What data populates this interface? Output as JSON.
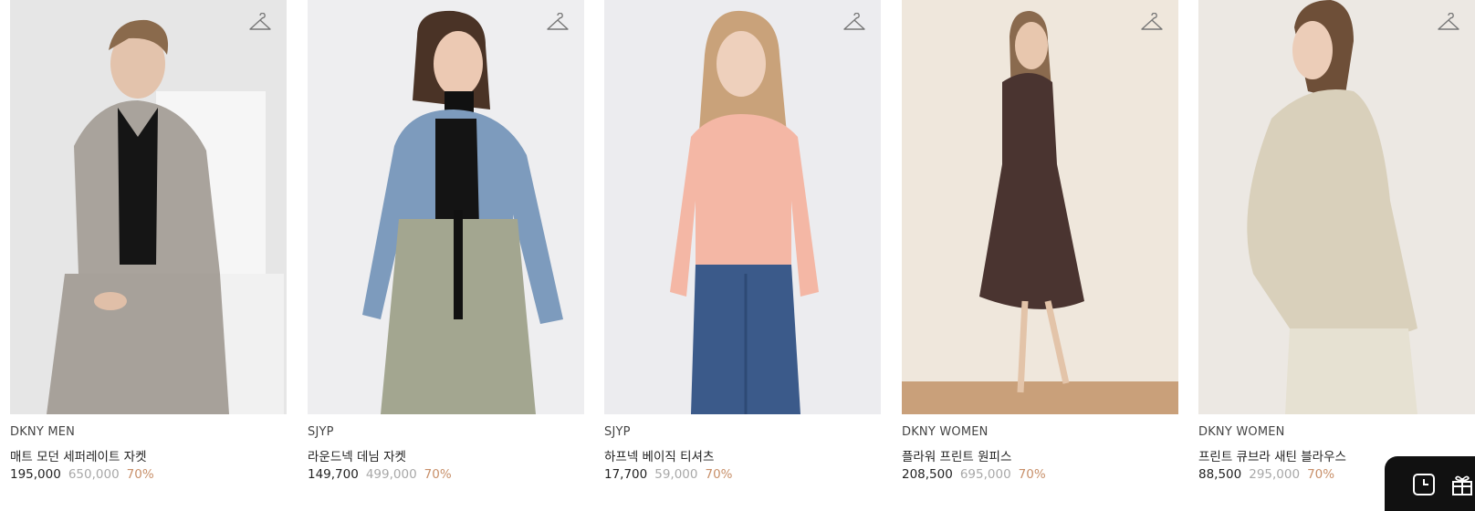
{
  "products": [
    {
      "brand": "DKNY MEN",
      "name": "매트 모던 세퍼레이트 자켓",
      "price": "195,000",
      "original_price": "650,000",
      "discount": "70%",
      "bg": "#e6e6e6"
    },
    {
      "brand": "SJYP",
      "name": "라운드넥 데님 자켓",
      "price": "149,700",
      "original_price": "499,000",
      "discount": "70%",
      "bg": "#eeeef0"
    },
    {
      "brand": "SJYP",
      "name": "하프넥 베이직 티셔츠",
      "price": "17,700",
      "original_price": "59,000",
      "discount": "70%",
      "bg": "#ececef"
    },
    {
      "brand": "DKNY WOMEN",
      "name": "플라워 프린트 원피스",
      "price": "208,500",
      "original_price": "695,000",
      "discount": "70%",
      "bg": "#efe7dc"
    },
    {
      "brand": "DKNY WOMEN",
      "name": "프린트 큐브라 새틴 블라우스",
      "price": "88,500",
      "original_price": "295,000",
      "discount": "70%",
      "bg": "#ece8e3"
    }
  ],
  "icons": {
    "wishlist": "hanger-icon",
    "floating": [
      "clock-icon",
      "gift-icon"
    ]
  },
  "colors": {
    "discount": "#c8906a",
    "original_price": "#a8a8a8",
    "floating_bg": "#111111"
  }
}
